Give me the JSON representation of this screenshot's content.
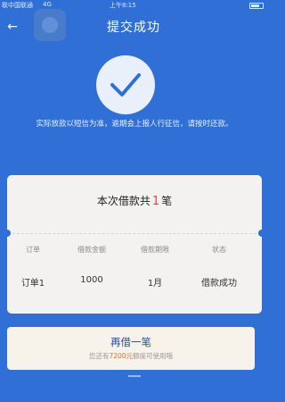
{
  "status_bar": {
    "carrier": "联中国联通",
    "network": "4G",
    "time": "上午8:15"
  },
  "header": {
    "title": "提交成功"
  },
  "notice": "实际放款以短信为准，逾期会上报人行征信，请按时还款。",
  "summary": {
    "prefix": "本次借款共",
    "count": "1",
    "suffix": "笔"
  },
  "table": {
    "headers": [
      "订单",
      "借款金额",
      "借款期限",
      "状态"
    ],
    "rows": [
      [
        "订单1",
        "1000",
        "1月",
        "借款成功"
      ]
    ]
  },
  "cta": {
    "label": "再借一笔",
    "sub_prefix": "您还有",
    "sub_amount": "7200元",
    "sub_suffix": "额度可使用哦"
  },
  "colors": {
    "primary": "#2f6fd6",
    "accent": "#e0483a",
    "card": "#f3f2f0"
  }
}
